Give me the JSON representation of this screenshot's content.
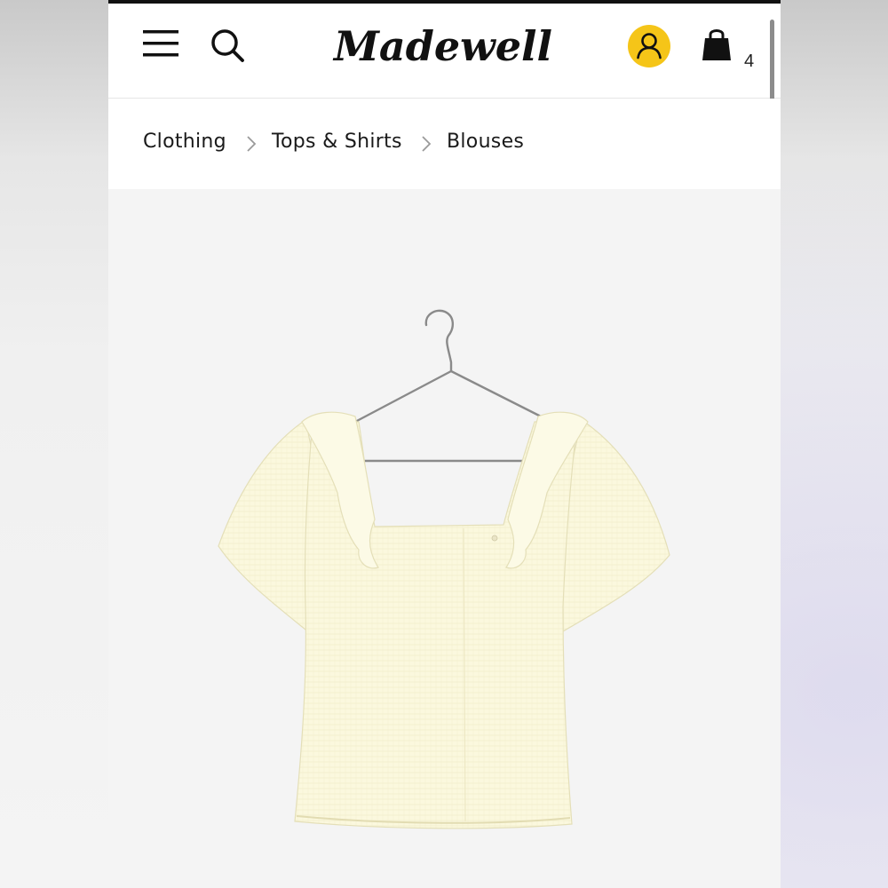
{
  "header": {
    "brand": "Madewell",
    "cart_count": "4",
    "icons": {
      "menu": "hamburger-menu-icon",
      "search": "search-icon",
      "account": "account-icon",
      "cart": "shopping-bag-icon"
    },
    "account_color": "#F5C518"
  },
  "breadcrumb": {
    "items": [
      "Clothing",
      "Tops & Shirts",
      "Blouses"
    ],
    "separator_icon": "chevron-right-icon"
  },
  "product": {
    "image": "product-photo",
    "fabric_color": "#FBF8DE"
  }
}
